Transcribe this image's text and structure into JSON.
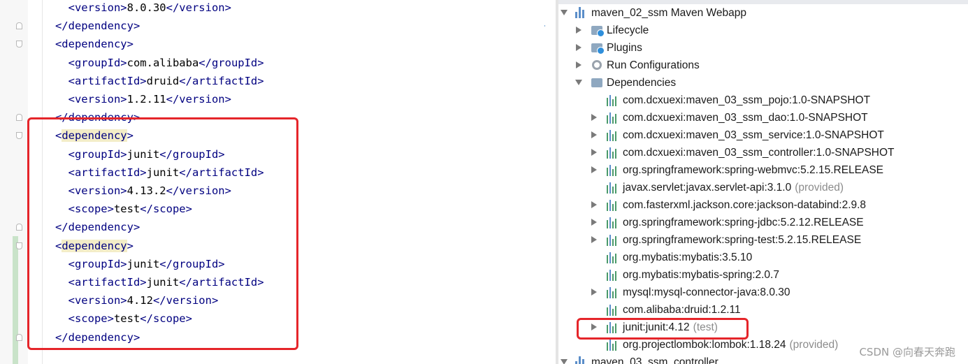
{
  "editor": {
    "lines": [
      [
        {
          "t": "    "
        },
        {
          "t": "<version>",
          "c": "tag"
        },
        {
          "t": "8.0.30",
          "c": "val"
        },
        {
          "t": "</version>",
          "c": "tag"
        }
      ],
      [
        {
          "t": "  "
        },
        {
          "t": "</dependency>",
          "c": "tag"
        }
      ],
      [
        {
          "t": "  "
        },
        {
          "t": "<dependency>",
          "c": "tag"
        }
      ],
      [
        {
          "t": "    "
        },
        {
          "t": "<groupId>",
          "c": "tag"
        },
        {
          "t": "com.alibaba",
          "c": "val"
        },
        {
          "t": "</groupId>",
          "c": "tag"
        }
      ],
      [
        {
          "t": "    "
        },
        {
          "t": "<artifactId>",
          "c": "tag"
        },
        {
          "t": "druid",
          "c": "val"
        },
        {
          "t": "</artifactId>",
          "c": "tag"
        }
      ],
      [
        {
          "t": "    "
        },
        {
          "t": "<version>",
          "c": "tag"
        },
        {
          "t": "1.2.11",
          "c": "val"
        },
        {
          "t": "</version>",
          "c": "tag"
        }
      ],
      [
        {
          "t": "  "
        },
        {
          "t": "</dependency>",
          "c": "tag"
        }
      ],
      [
        {
          "t": "  "
        },
        {
          "t": "<",
          "c": "tag"
        },
        {
          "t": "dependency",
          "c": "tag hl"
        },
        {
          "t": ">",
          "c": "tag"
        }
      ],
      [
        {
          "t": "    "
        },
        {
          "t": "<groupId>",
          "c": "tag"
        },
        {
          "t": "junit",
          "c": "val"
        },
        {
          "t": "</groupId>",
          "c": "tag"
        }
      ],
      [
        {
          "t": "    "
        },
        {
          "t": "<artifactId>",
          "c": "tag"
        },
        {
          "t": "junit",
          "c": "val"
        },
        {
          "t": "</artifactId>",
          "c": "tag"
        }
      ],
      [
        {
          "t": "    "
        },
        {
          "t": "<version>",
          "c": "tag"
        },
        {
          "t": "4.13.2",
          "c": "val"
        },
        {
          "t": "</version>",
          "c": "tag"
        }
      ],
      [
        {
          "t": "    "
        },
        {
          "t": "<scope>",
          "c": "tag"
        },
        {
          "t": "test",
          "c": "val"
        },
        {
          "t": "</scope>",
          "c": "tag"
        }
      ],
      [
        {
          "t": "  "
        },
        {
          "t": "</dependency>",
          "c": "tag"
        }
      ],
      [
        {
          "t": "  "
        },
        {
          "t": "<",
          "c": "tag"
        },
        {
          "t": "dependency",
          "c": "tag hl"
        },
        {
          "t": ">",
          "c": "tag"
        }
      ],
      [
        {
          "t": "    "
        },
        {
          "t": "<groupId>",
          "c": "tag"
        },
        {
          "t": "junit",
          "c": "val"
        },
        {
          "t": "</groupId>",
          "c": "tag"
        }
      ],
      [
        {
          "t": "    "
        },
        {
          "t": "<artifactId>",
          "c": "tag"
        },
        {
          "t": "junit",
          "c": "val"
        },
        {
          "t": "</artifactId>",
          "c": "tag"
        }
      ],
      [
        {
          "t": "    "
        },
        {
          "t": "<version>",
          "c": "tag"
        },
        {
          "t": "4.12",
          "c": "val"
        },
        {
          "t": "</version>",
          "c": "tag"
        }
      ],
      [
        {
          "t": "    "
        },
        {
          "t": "<scope>",
          "c": "tag"
        },
        {
          "t": "test",
          "c": "val"
        },
        {
          "t": "</scope>",
          "c": "tag"
        }
      ],
      [
        {
          "t": "  "
        },
        {
          "t": "</dependency>",
          "c": "tag"
        }
      ]
    ]
  },
  "project_tree": {
    "module": "maven_02_ssm Maven Webapp",
    "lifecycle": "Lifecycle",
    "plugins": "Plugins",
    "run_configurations": "Run Configurations",
    "dependencies": "Dependencies",
    "next_module": "maven_03_ssm_controller",
    "deps": [
      {
        "name": "com.dcxuexi:maven_03_ssm_pojo:1.0-SNAPSHOT",
        "scope": "",
        "expandable": false
      },
      {
        "name": "com.dcxuexi:maven_03_ssm_dao:1.0-SNAPSHOT",
        "scope": "",
        "expandable": true
      },
      {
        "name": "com.dcxuexi:maven_03_ssm_service:1.0-SNAPSHOT",
        "scope": "",
        "expandable": true
      },
      {
        "name": "com.dcxuexi:maven_03_ssm_controller:1.0-SNAPSHOT",
        "scope": "",
        "expandable": true
      },
      {
        "name": "org.springframework:spring-webmvc:5.2.15.RELEASE",
        "scope": "",
        "expandable": true
      },
      {
        "name": "javax.servlet:javax.servlet-api:3.1.0",
        "scope": "(provided)",
        "expandable": false
      },
      {
        "name": "com.fasterxml.jackson.core:jackson-databind:2.9.8",
        "scope": "",
        "expandable": true
      },
      {
        "name": "org.springframework:spring-jdbc:5.2.12.RELEASE",
        "scope": "",
        "expandable": true
      },
      {
        "name": "org.springframework:spring-test:5.2.15.RELEASE",
        "scope": "",
        "expandable": true
      },
      {
        "name": "org.mybatis:mybatis:3.5.10",
        "scope": "",
        "expandable": false
      },
      {
        "name": "org.mybatis:mybatis-spring:2.0.7",
        "scope": "",
        "expandable": false
      },
      {
        "name": "mysql:mysql-connector-java:8.0.30",
        "scope": "",
        "expandable": true
      },
      {
        "name": "com.alibaba:druid:1.2.11",
        "scope": "",
        "expandable": false
      },
      {
        "name": "junit:junit:4.12",
        "scope": "(test)",
        "expandable": true
      },
      {
        "name": "org.projectlombok:lombok:1.18.24",
        "scope": "(provided)",
        "expandable": false
      }
    ]
  },
  "watermark": "CSDN @向春天奔跑",
  "colors": {
    "highlight_box": "#e5252a",
    "xml_tag": "#000080",
    "tag_highlight": "#f3edc8"
  }
}
